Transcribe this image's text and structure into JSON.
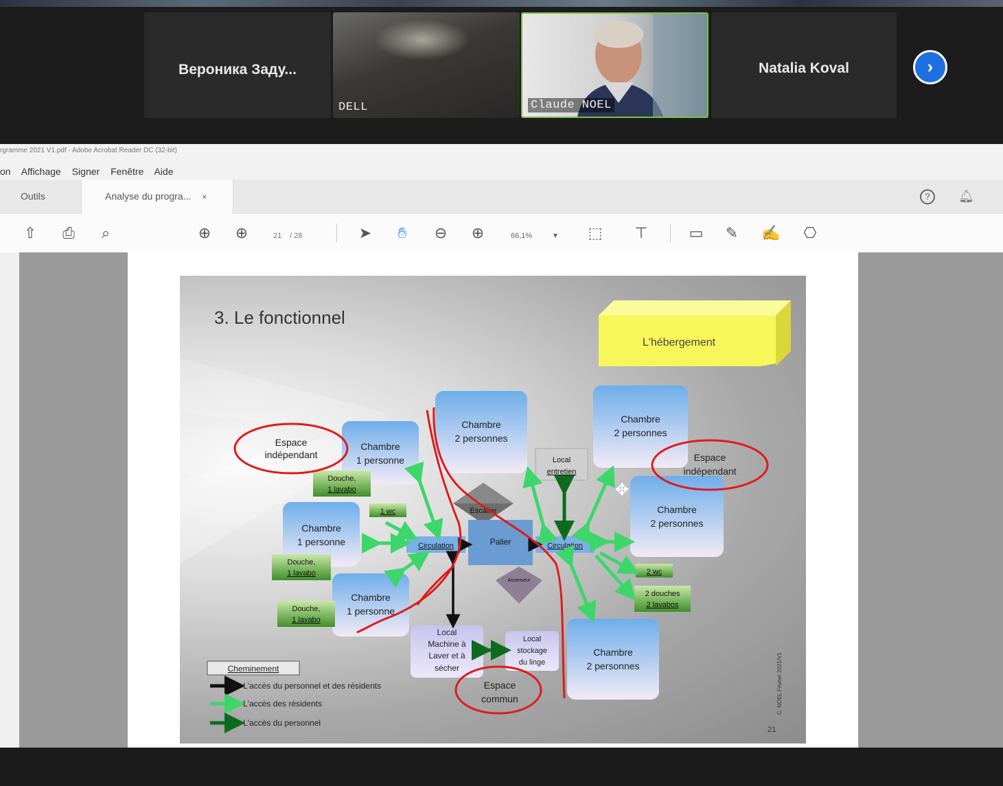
{
  "zoom": {
    "participants": [
      {
        "name": "Вероника  Заду..."
      },
      {
        "name": "DELL"
      },
      {
        "name": "Claude NOEL"
      },
      {
        "name": "Natalia Koval"
      }
    ],
    "next_icon": "chevron-right-icon"
  },
  "acrobat": {
    "window_title": "rgramme 2021 V1.pdf - Adobe Acrobat Reader DC (32-bit)",
    "menu": [
      "on",
      "Affichage",
      "Signer",
      "Fenêtre",
      "Aide"
    ],
    "tabs": {
      "tools": "Outils",
      "document": "Analyse du progra...",
      "close": "×"
    },
    "page_current": "21",
    "page_total": "/ 28",
    "zoom_level": "66,1%"
  },
  "slide": {
    "title": "3. Le fonctionnel",
    "box_3d": "L'hébergement",
    "rooms": {
      "c1_top": [
        "Chambre",
        "1 personne"
      ],
      "c1_mid": [
        "Chambre",
        "1 personne"
      ],
      "c1_bot": [
        "Chambre",
        "1 personne"
      ],
      "c2_top": [
        "Chambre",
        "2 personnes"
      ],
      "c2_topright": [
        "Chambre",
        "2 personnes"
      ],
      "c2_right": [
        "Chambre",
        "2 personnes"
      ],
      "c2_bot": [
        "Chambre",
        "2 personnes"
      ]
    },
    "douche_top": [
      "Douche,",
      "1 lavabo"
    ],
    "douche_mid": [
      "Douche,",
      "1 lavabo"
    ],
    "douche_bot": [
      "Douche,",
      "1 lavabo"
    ],
    "wc_left": "1 wc",
    "wc_right": "2 wc",
    "douches_right": [
      "2 douches",
      "2 lavabos"
    ],
    "local_entretien": [
      "Local",
      "entretien"
    ],
    "escalier": "Escalier",
    "ascenseur": "Ascenseur",
    "palier": "Palier",
    "circulation_left": "Circulation",
    "circulation_right": "Circulation",
    "local_machine": [
      "Local",
      "Machine à",
      "Laver et à",
      "sécher"
    ],
    "local_stockage": [
      "Local",
      "stockage",
      "du linge"
    ],
    "espace_left": [
      "Espace",
      "indépendant"
    ],
    "espace_right": [
      "Espace",
      "indépendant"
    ],
    "espace_commun": [
      "Espace",
      "commun"
    ],
    "legend": {
      "title": "Cheminement",
      "items": [
        "L'accès du personnel et des résidents",
        "L'accès des résidents",
        "L'accès du personnel"
      ]
    },
    "copyright": "C. NOEL Février 2021/V1",
    "page_number": "21"
  },
  "colors": {
    "zoom_blue": "#1e6fe0",
    "room_blue": "#7fb7ec",
    "green_box": "#5aa43a",
    "yellow_box": "#f7f75a",
    "annotation_red": "#e01a1a",
    "resident_arrow": "#3dd66a",
    "staff_arrow": "#0d6b1e"
  }
}
